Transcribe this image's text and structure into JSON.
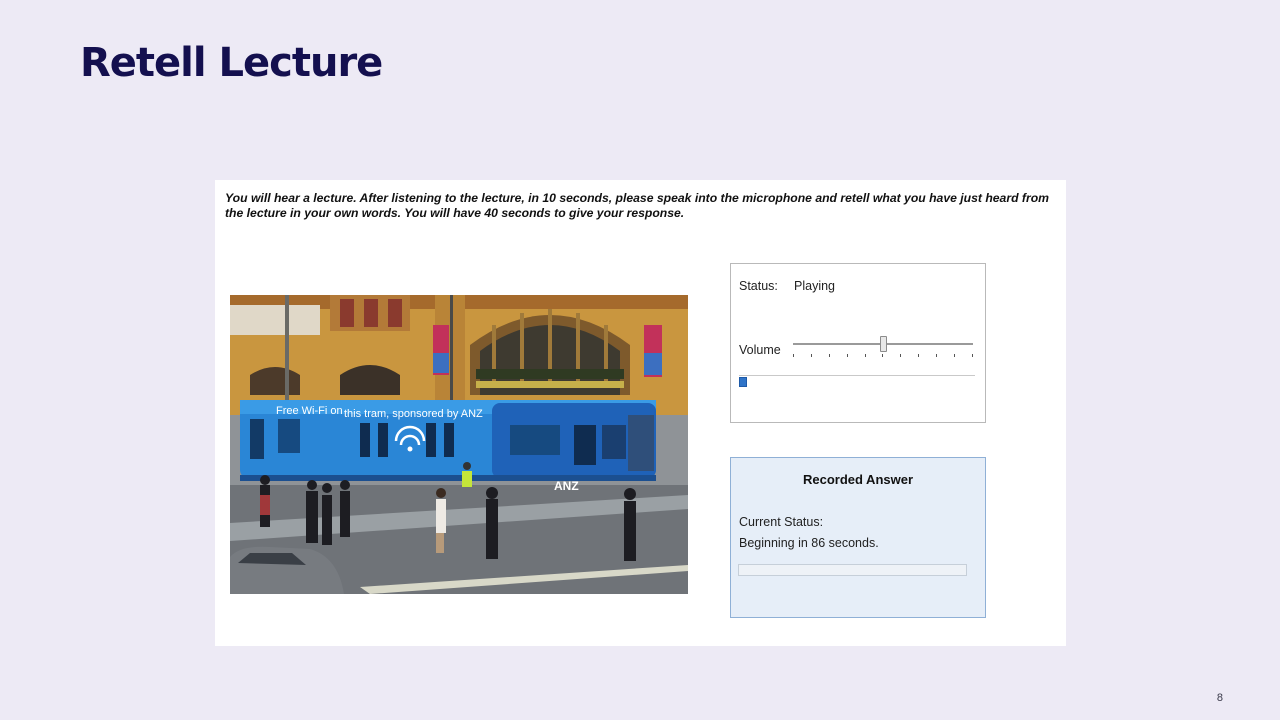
{
  "slide": {
    "title": "Retell Lecture",
    "page_number": "8"
  },
  "task": {
    "instructions": "You will hear a lecture. After listening to the lecture, in 10 seconds, please speak into the microphone and retell what you have just heard from the lecture in your own words. You will have 40 seconds to give your response."
  },
  "photo": {
    "tram_text_1": "Free Wi-Fi on",
    "tram_text_2": "this tram, sponsored by ANZ",
    "tram_brand": "ANZ"
  },
  "player": {
    "status_label": "Status:",
    "status_value": "Playing",
    "volume_label": "Volume",
    "volume_level": 0.5,
    "playback_progress": 0.02
  },
  "recorder": {
    "title": "Recorded Answer",
    "current_status_label": "Current Status:",
    "current_status_value": "Beginning in 86 seconds.",
    "record_progress": 0
  },
  "colors": {
    "title": "#14104f",
    "background": "#edeaf5",
    "progress": "#2f74c8",
    "recorder_background": "#e6eef8"
  }
}
